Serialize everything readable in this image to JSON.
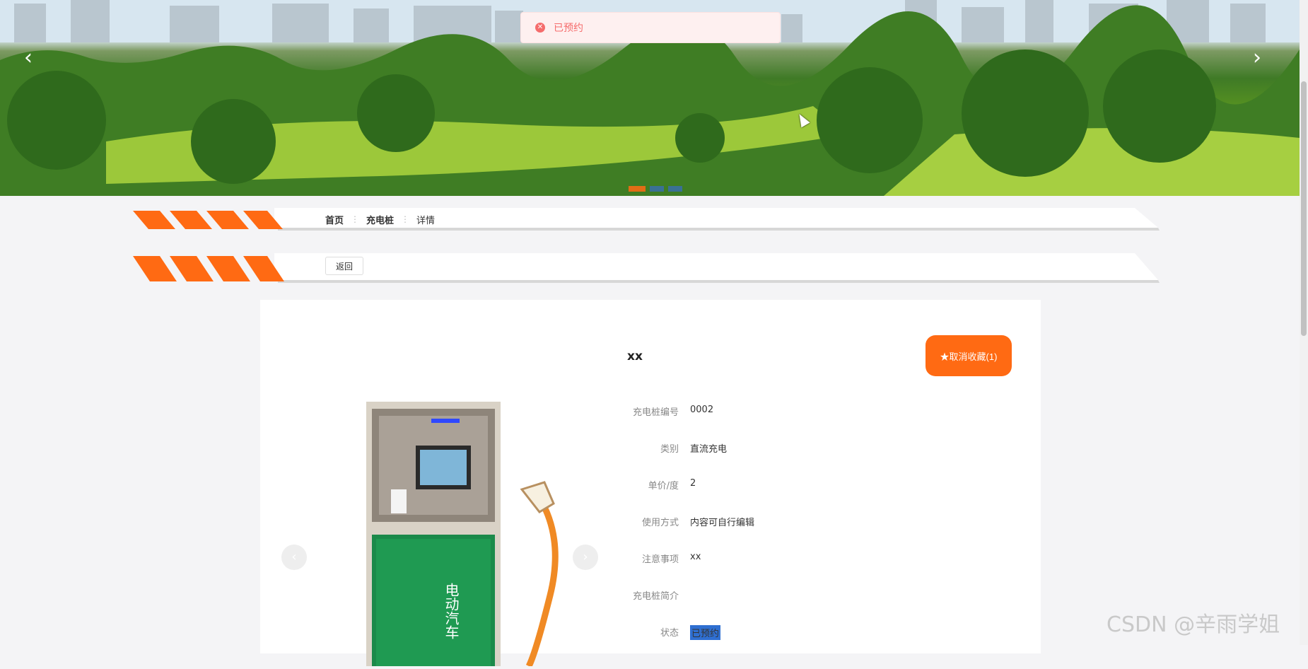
{
  "banner": {
    "prev": "‹",
    "next": "›",
    "slides": 3,
    "active_slide": 0
  },
  "toast": {
    "icon": "close-circle-icon",
    "text": "已预约"
  },
  "breadcrumb": {
    "items": [
      "首页",
      "充电桩",
      "详情"
    ],
    "separator": "⋮"
  },
  "actions": {
    "back_label": "返回"
  },
  "detail": {
    "title": "xx",
    "favorite_label": "★取消收藏(1)",
    "image_caption": "电动汽车",
    "fields": [
      {
        "label": "充电桩编号",
        "value": "0002"
      },
      {
        "label": "类别",
        "value": "直流充电"
      },
      {
        "label": "单价/度",
        "value": "2"
      },
      {
        "label": "使用方式",
        "value": "内容可自行编辑"
      },
      {
        "label": "注意事项",
        "value": "xx"
      },
      {
        "label": "充电桩简介",
        "value": ""
      },
      {
        "label": "状态",
        "value": "已预约"
      }
    ]
  },
  "watermark": "CSDN @辛雨学姐",
  "colors": {
    "accent": "#ff6a13",
    "error": "#f56c6c",
    "selection": "#2f6fd1"
  }
}
